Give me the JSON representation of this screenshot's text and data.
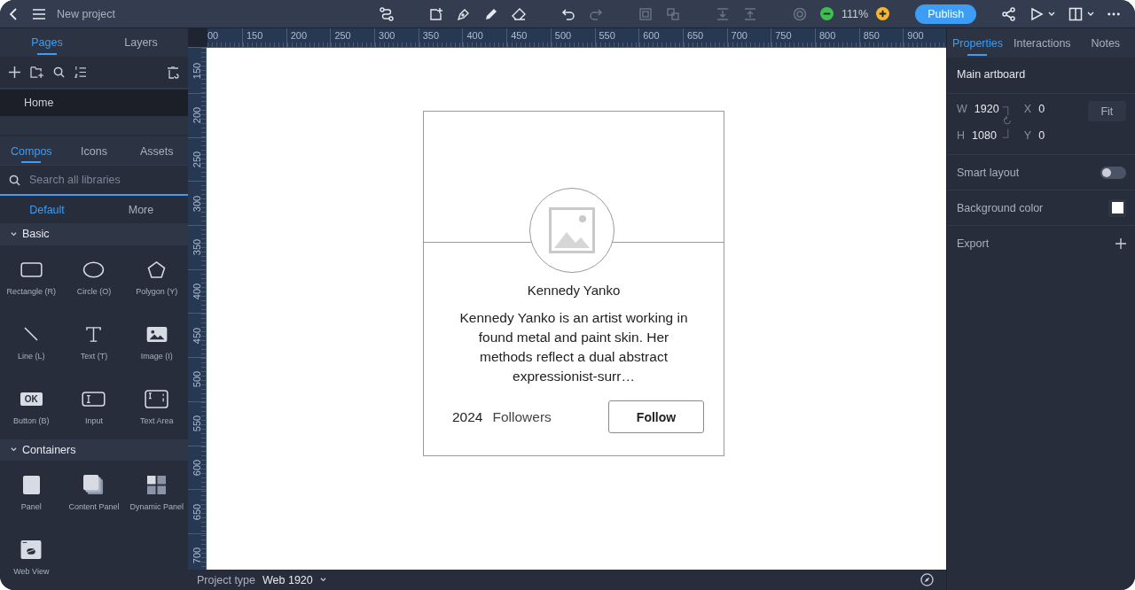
{
  "topbar": {
    "project_name": "New project",
    "zoom": "111%",
    "publish": "Publish"
  },
  "left_panel": {
    "tabs": [
      {
        "label": "Pages",
        "selected": true
      },
      {
        "label": "Layers",
        "selected": false
      }
    ],
    "pages": [
      {
        "label": "Home",
        "selected": true
      }
    ],
    "library_tabs": [
      {
        "label": "Compos",
        "selected": true
      },
      {
        "label": "Icons",
        "selected": false
      },
      {
        "label": "Assets",
        "selected": false
      }
    ],
    "search": {
      "placeholder": "Search all libraries"
    },
    "library_subtabs": [
      {
        "label": "Default",
        "selected": true
      },
      {
        "label": "More",
        "selected": false
      }
    ],
    "sections": [
      {
        "title": "Basic",
        "expanded": true,
        "items": [
          {
            "label": "Rectangle (R)",
            "kind": "rectangle"
          },
          {
            "label": "Circle (O)",
            "kind": "circle"
          },
          {
            "label": "Polygon (Y)",
            "kind": "polygon"
          },
          {
            "label": "Line (L)",
            "kind": "line"
          },
          {
            "label": "Text (T)",
            "kind": "text"
          },
          {
            "label": "Image (I)",
            "kind": "image"
          },
          {
            "label": "Button (B)",
            "kind": "button",
            "glyph": "OK"
          },
          {
            "label": "Input",
            "kind": "input"
          },
          {
            "label": "Text Area",
            "kind": "textarea"
          }
        ]
      },
      {
        "title": "Containers",
        "expanded": true,
        "items": [
          {
            "label": "Panel",
            "kind": "panel"
          },
          {
            "label": "Content Panel",
            "kind": "content-panel"
          },
          {
            "label": "Dynamic Panel",
            "kind": "dynamic-panel"
          },
          {
            "label": "Web View",
            "kind": "webview"
          }
        ]
      }
    ]
  },
  "rulers": {
    "horizontal": [
      "00",
      "150",
      "200",
      "250",
      "300",
      "350",
      "400",
      "450",
      "500",
      "550",
      "600",
      "650",
      "700",
      "750",
      "800",
      "850",
      "900"
    ],
    "vertical": [
      "150",
      "200",
      "250",
      "300",
      "350",
      "400",
      "450",
      "500",
      "550",
      "600",
      "650",
      "700"
    ]
  },
  "artboard": {
    "card": {
      "name": "Kennedy Yanko",
      "bio": "Kennedy Yanko is an artist working in found metal and paint skin. Her methods reflect a dual abstract expressionist-surr…",
      "followers_count": "2024",
      "followers_label": "Followers",
      "button": "Follow"
    }
  },
  "right_panel": {
    "tabs": [
      {
        "label": "Properties",
        "selected": true
      },
      {
        "label": "Interactions",
        "selected": false
      },
      {
        "label": "Notes",
        "selected": false
      }
    ],
    "title": "Main artboard",
    "size": [
      {
        "label": "W",
        "value": "1920"
      },
      {
        "label": "H",
        "value": "1080"
      }
    ],
    "position": [
      {
        "label": "X",
        "value": "0"
      },
      {
        "label": "Y",
        "value": "0"
      }
    ],
    "fit_button": "Fit",
    "rows": [
      {
        "kind": "toggle",
        "label": "Smart layout",
        "on": false
      },
      {
        "kind": "color",
        "label": "Background color",
        "color": "#ffffff"
      },
      {
        "kind": "add",
        "label": "Export"
      }
    ]
  },
  "status_bar": {
    "label": "Project type",
    "value": "Web 1920"
  }
}
